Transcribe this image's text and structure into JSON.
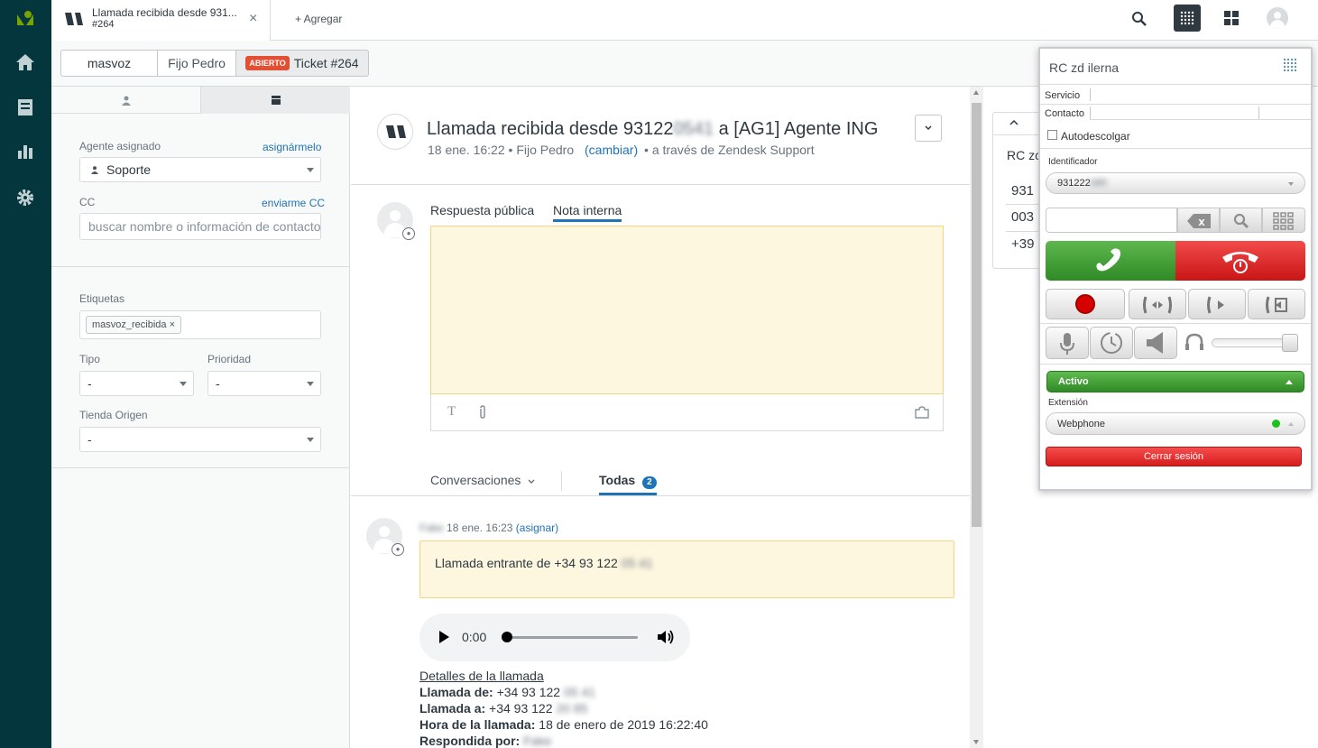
{
  "tab": {
    "title": "Llamada recibida desde 931...",
    "subtitle": "#264",
    "close": "×"
  },
  "add_tab": "+ Agregar",
  "breadcrumb": {
    "org": "masvoz",
    "requester": "Fijo Pedro",
    "status": "ABIERTO",
    "ticket": "Ticket #264"
  },
  "left": {
    "assignee_label": "Agente asignado",
    "assign_me": "asignármelo",
    "assignee_value": "Soporte",
    "cc_label": "CC",
    "cc_me": "enviarme CC",
    "cc_placeholder": "buscar nombre o información de contacto",
    "tags_label": "Etiquetas",
    "tag": "masvoz_recibida",
    "type_label": "Tipo",
    "type_value": "-",
    "priority_label": "Prioridad",
    "priority_value": "-",
    "store_label": "Tienda Origen",
    "store_value": "-"
  },
  "ticket": {
    "title_a": "Llamada recibida desde 93122",
    "title_blur": "0541",
    "title_b": " a [AG1] Agente ING",
    "meta_a": "18 ene. 16:22 • Fijo Pedro",
    "meta_change": "(cambiar)",
    "meta_b": "• a través de Zendesk Support"
  },
  "composer": {
    "public_tab": "Respuesta pública",
    "internal_tab": "Nota interna"
  },
  "filters": {
    "conversations": "Conversaciones",
    "all": "Todas",
    "all_count": "2"
  },
  "event": {
    "author": "Fake",
    "time": "18 ene. 16:23",
    "assign": "(asignar)",
    "note_a": "Llamada entrante de +34 93 122",
    "note_blur": "05 41",
    "audio_time": "0:00",
    "details_title": "Detalles de la llamada",
    "from_label": "Llamada de:",
    "from_value": "+34 93 122",
    "from_blur": "05 41",
    "to_label": "Llamada a:",
    "to_value": "+34 93 122",
    "to_blur": "20 85",
    "time_label": "Hora de la llamada:",
    "time_value": "18 de enero de 2019 16:22:40",
    "answered_label": "Respondida por:",
    "answered_blur": "Fake"
  },
  "side_panel": {
    "title": "RC zc",
    "rows": [
      "931",
      "003",
      "+39"
    ]
  },
  "phone": {
    "title": "RC zd ilerna",
    "service_label": "Servicio",
    "contact_label": "Contacto",
    "auto_answer": "Autodescolgar",
    "caller_id_label": "Identificador",
    "caller_id_value": "931222",
    "caller_id_blur": "085",
    "status": "Activo",
    "extension_label": "Extensión",
    "extension_value": "Webphone",
    "logout": "Cerrar sesión",
    "clear_key": "x"
  },
  "colors": {
    "sidebar": "#03363d",
    "link": "#1f73b7",
    "open_badge": "#e34f32",
    "note_bg": "#fef7e0",
    "active_green": "#3d9b35",
    "hangup_red": "#e12a2a"
  }
}
